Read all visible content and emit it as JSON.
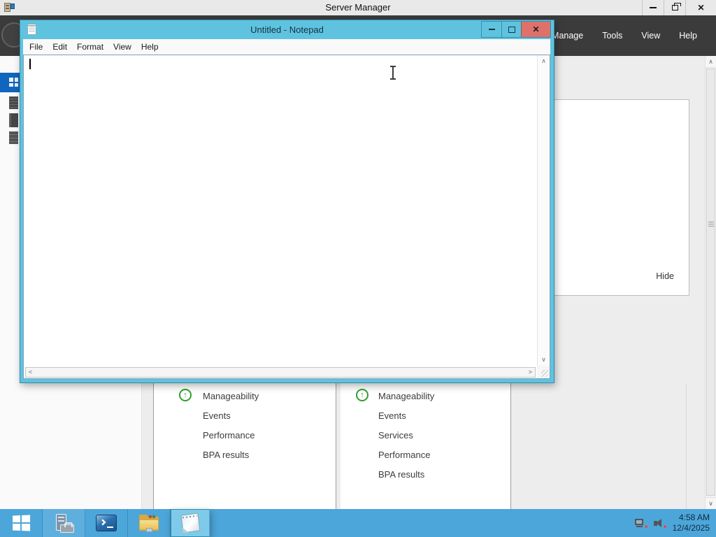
{
  "icons": {
    "close": "✕",
    "scroll_up": "∧",
    "scroll_down": "∨",
    "scroll_left": "<",
    "scroll_right": ">",
    "status_up_arrow": "↑",
    "error_badge": "✕"
  },
  "server_manager": {
    "window_title": "Server Manager",
    "menu": [
      "Manage",
      "Tools",
      "View",
      "Help"
    ],
    "welcome_panel": {
      "hide_label": "Hide"
    },
    "tiles": [
      {
        "items": [
          "Manageability",
          "Events",
          "Performance",
          "BPA results"
        ]
      },
      {
        "items": [
          "Manageability",
          "Events",
          "Services",
          "Performance",
          "BPA results"
        ]
      }
    ]
  },
  "notepad": {
    "window_title": "Untitled - Notepad",
    "menu": [
      "File",
      "Edit",
      "Format",
      "View",
      "Help"
    ],
    "text_content": ""
  },
  "taskbar": {
    "clock": {
      "time": "4:58 AM",
      "date": "12/4/2025"
    }
  },
  "colors": {
    "taskbar_blue": "#4CA6DA",
    "notepad_chrome": "#5FC3E0",
    "close_button_red": "#DF716B",
    "selection_blue": "#1065BE",
    "status_green": "#2FA02F",
    "header_dark": "#3B3B3B"
  }
}
